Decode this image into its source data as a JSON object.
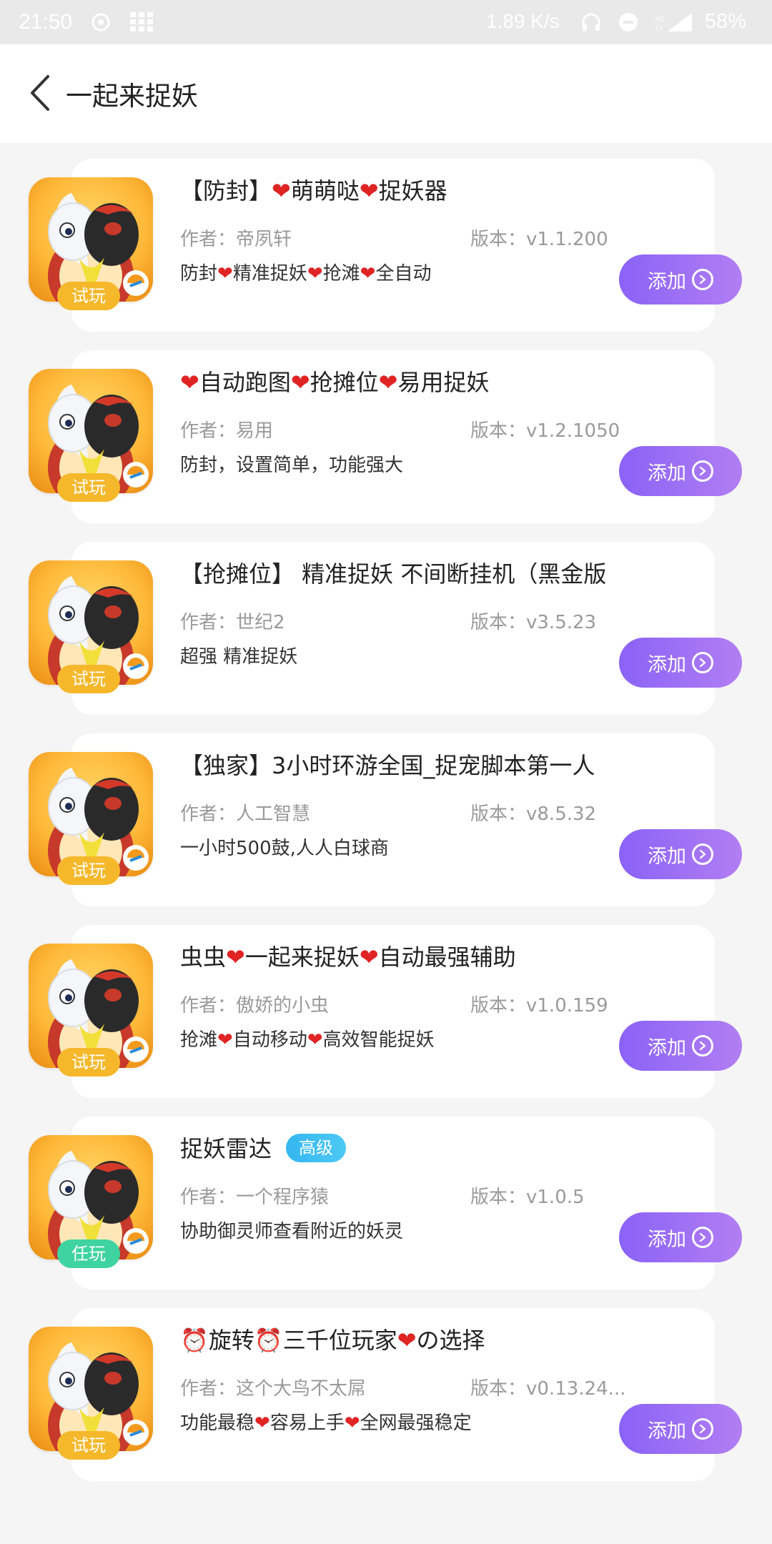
{
  "status_bar": {
    "time": "21:50",
    "speed": "1.89 K/s",
    "battery": "58%",
    "icons": [
      "netease-icon",
      "grid-icon",
      "headphones-icon",
      "dnd-icon",
      "signal-icon"
    ]
  },
  "header": {
    "title": "一起来捉妖",
    "back_icon": "chevron-left-icon"
  },
  "add_label": "添加",
  "items": [
    {
      "title": "【防封】❤萌萌哒❤捉妖器",
      "author": "作者：帝夙轩",
      "version": "版本：v1.1.200",
      "desc": "防封❤精准捉妖❤抢滩❤全自动",
      "badge": "试玩",
      "level": ""
    },
    {
      "title": "❤自动跑图❤抢摊位❤易用捉妖",
      "author": "作者：易用",
      "version": "版本：v1.2.1050",
      "desc": "防封，设置简单，功能强大",
      "badge": "试玩",
      "level": ""
    },
    {
      "title": "【抢摊位】 精准捉妖 不间断挂机（黑金版",
      "author": "作者：世纪2",
      "version": "版本：v3.5.23",
      "desc": "超强 精准捉妖",
      "badge": "试玩",
      "level": ""
    },
    {
      "title": "【独家】3小时环游全国_捉宠脚本第一人",
      "author": "作者：人工智慧",
      "version": "版本：v8.5.32",
      "desc": "一小时500鼓,人人白球商",
      "badge": "试玩",
      "level": ""
    },
    {
      "title": "虫虫❤一起来捉妖❤自动最强辅助",
      "author": "作者：傲娇的小虫",
      "version": "版本：v1.0.159",
      "desc": "抢滩❤自动移动❤高效智能捉妖",
      "badge": "试玩",
      "level": ""
    },
    {
      "title": "捉妖雷达",
      "author": "作者：一个程序猿",
      "version": "版本：v1.0.5",
      "desc": "协助御灵师查看附近的妖灵",
      "badge": "任玩",
      "level": "高级"
    },
    {
      "title": "⏰旋转⏰三千位玩家❤の选择",
      "author": "作者：这个大鸟不太屌",
      "version": "版本：v0.13.24...",
      "desc": "功能最稳❤容易上手❤全网最强稳定",
      "badge": "试玩",
      "level": ""
    }
  ],
  "colors": {
    "accent_start": "#8a62f6",
    "accent_end": "#b27ef3",
    "badge_trial": "#f5b82a",
    "badge_task": "#3ed3a0",
    "level_tag": "#34b6f0",
    "heart": "#e02424"
  }
}
